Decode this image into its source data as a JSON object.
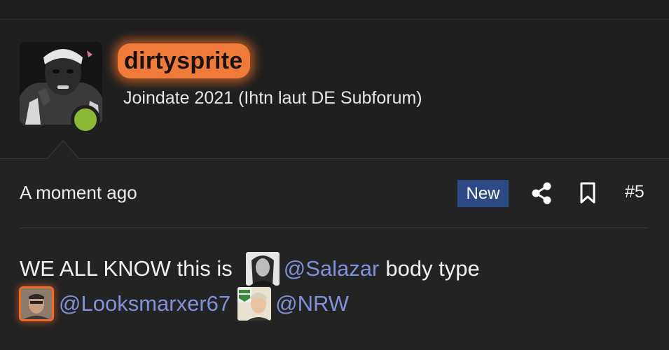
{
  "post": {
    "username": "dirtysprite",
    "joindate": "Joindate 2021 (Ihtn laut DE Subforum)",
    "time": "A moment ago",
    "badge": "New",
    "number": "#5"
  },
  "content": {
    "text1": "WE ALL KNOW this is",
    "mention1": "@Salazar",
    "text2": "body type",
    "mention2": "@Looksmarxer67",
    "mention3": "@NRW"
  },
  "colors": {
    "username_highlight": "#ef7a3a",
    "online_status": "#8cb836",
    "badge_bg": "#2d4a87",
    "mention": "#8191d9"
  },
  "icons": [
    "share-icon",
    "bookmark-icon"
  ]
}
